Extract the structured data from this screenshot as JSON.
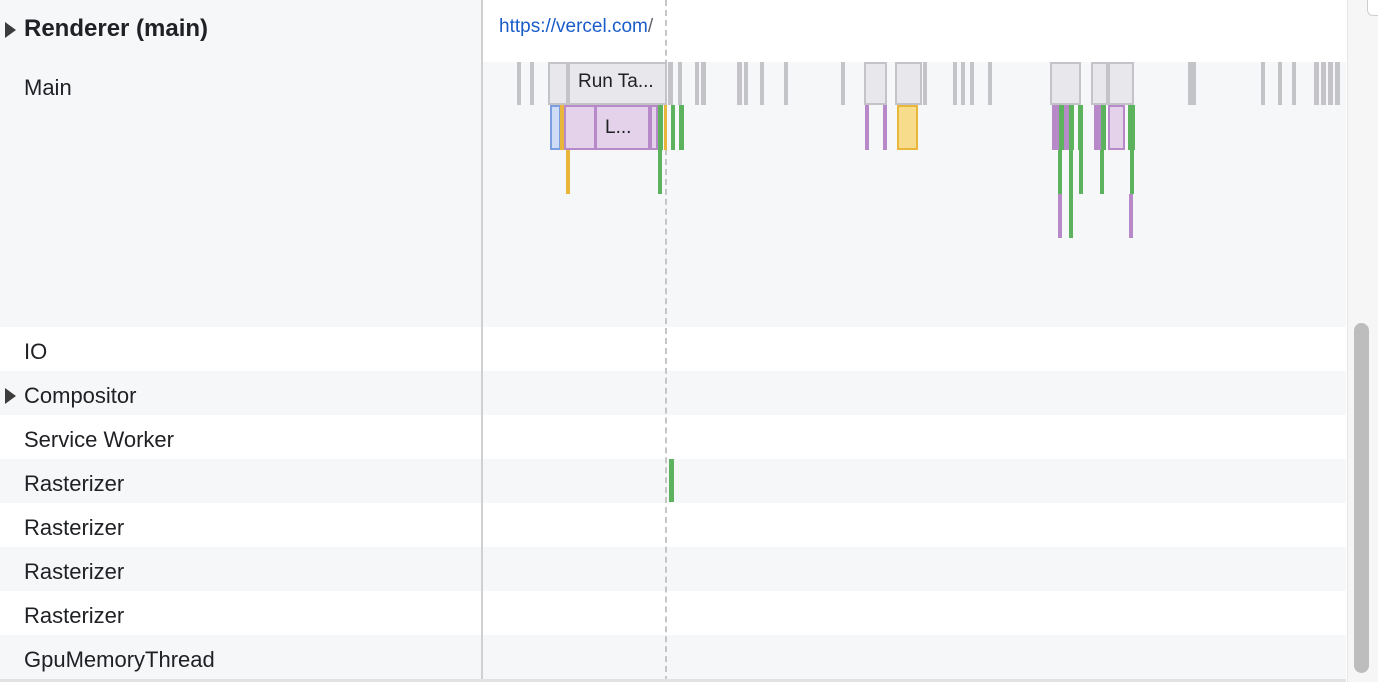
{
  "colors": {
    "row_alt": "#f5f7f9",
    "row_plain": "#ffffff",
    "task_gray": "#c4c4c8",
    "task_fill": "#e8e8ec",
    "scripting": "#b889c9",
    "scripting_fill": "#e3d2ea",
    "rendering_fill": "#f7dc8b",
    "rendering": "#e8b63a",
    "painting": "#5db35d",
    "loading": "#7c9ee0",
    "link": "#1a5dc9"
  },
  "tracks": {
    "renderer": {
      "title": "Renderer (main)",
      "url_host": "https://vercel.com",
      "url_path": "/",
      "expand_icon": "triangle-right-icon"
    },
    "main_label": "Main",
    "threads": [
      {
        "label": "IO",
        "expandable": false
      },
      {
        "label": "Compositor",
        "expandable": true
      },
      {
        "label": "Service Worker",
        "expandable": false
      },
      {
        "label": "Rasterizer",
        "expandable": false
      },
      {
        "label": "Rasterizer",
        "expandable": false
      },
      {
        "label": "Rasterizer",
        "expandable": false
      },
      {
        "label": "Rasterizer",
        "expandable": false
      },
      {
        "label": "GpuMemoryThread",
        "expandable": false
      }
    ]
  },
  "events": {
    "run_task_label": "Run Ta...",
    "load_label": "L..."
  },
  "scrollbar": {
    "orientation": "vertical"
  }
}
